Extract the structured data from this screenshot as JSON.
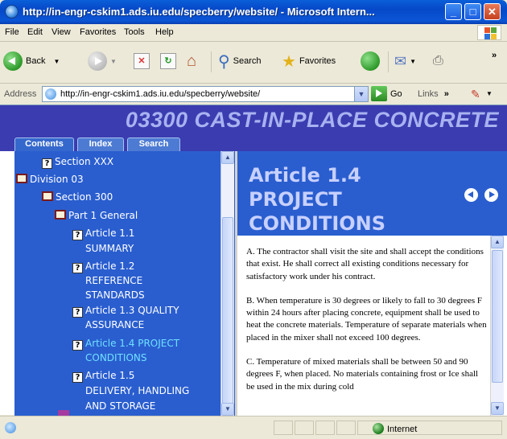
{
  "window": {
    "title": "http://in-engr-cskim1.ads.iu.edu/specberry/website/ - Microsoft Intern...",
    "min": "_",
    "max": "□",
    "close": "✕"
  },
  "menu": [
    "File",
    "Edit",
    "View",
    "Favorites",
    "Tools",
    "Help"
  ],
  "toolbar": {
    "back": "Back",
    "search": "Search",
    "favorites": "Favorites",
    "chevron": "»"
  },
  "address": {
    "label": "Address",
    "url": "http://in-engr-cskim1.ads.iu.edu/specberry/website/",
    "go": "Go",
    "links": "Links",
    "chevron": "»"
  },
  "banner": {
    "title": "03300 CAST-IN-PLACE CONCRETE"
  },
  "tabs": [
    "Contents",
    "Index",
    "Search"
  ],
  "toc": [
    {
      "label": "Section XXX",
      "icon": "help-page-icon"
    },
    {
      "label": "Division 03",
      "icon": "book-icon"
    },
    {
      "label": "Section 300",
      "icon": "book-icon"
    },
    {
      "label": "Part 1 General",
      "icon": "book-icon"
    },
    {
      "label": [
        "Article 1.1",
        "SUMMARY"
      ],
      "icon": "help-page-icon"
    },
    {
      "label": [
        "Article 1.2",
        "REFERENCE",
        "STANDARDS"
      ],
      "icon": "help-page-icon"
    },
    {
      "label": [
        "Article 1.3 QUALITY",
        "ASSURANCE"
      ],
      "icon": "help-page-icon"
    },
    {
      "label": [
        "Article 1.4 PROJECT",
        "CONDITIONS"
      ],
      "icon": "help-page-icon",
      "active": true
    },
    {
      "label": [
        "Article 1.5",
        "DELIVERY, HANDLING",
        "AND STORAGE"
      ],
      "icon": "help-page-icon"
    }
  ],
  "article": {
    "title_lines": [
      "Article 1.4",
      "PROJECT",
      "CONDITIONS"
    ],
    "paragraphs": [
      "A. The contractor shall visit the site and shall accept the conditions that exist. He shall correct all existing conditions necessary for satisfactory work under his contract.",
      "B.  When temperature is 30 degrees or likely to fall to 30 degrees F within 24 hours after placing concrete, equipment shall be used to heat the concrete materials. Temperature of separate materials when placed in the mixer shall not exceed 100 degrees.",
      "C. Temperature of mixed materials shall be between 50 and 90 degrees F, when placed. No materials containing frost or Ice shall be used in the mix during cold"
    ]
  },
  "status": {
    "zone": "Internet"
  }
}
